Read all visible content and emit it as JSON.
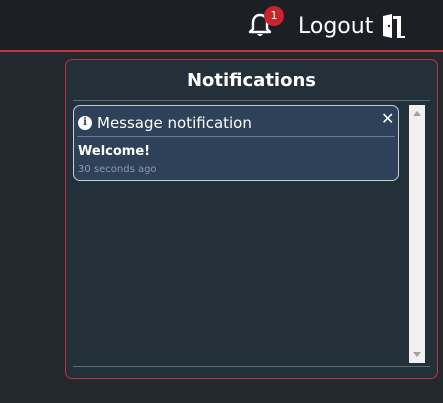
{
  "header": {
    "notification_count": "1",
    "logout_label": "Logout",
    "icons": {
      "bell": "bell-icon",
      "door": "door-icon"
    }
  },
  "panel": {
    "title": "Notifications",
    "notifications": [
      {
        "title": "Message notification",
        "body": "Welcome!",
        "time": "30 seconds ago",
        "icon": "info-icon",
        "close_symbol": "✕"
      }
    ]
  },
  "colors": {
    "accent_red": "#c5343b",
    "badge_red": "#c7252c",
    "card_bg": "#2e4158",
    "panel_bg": "#233039"
  }
}
